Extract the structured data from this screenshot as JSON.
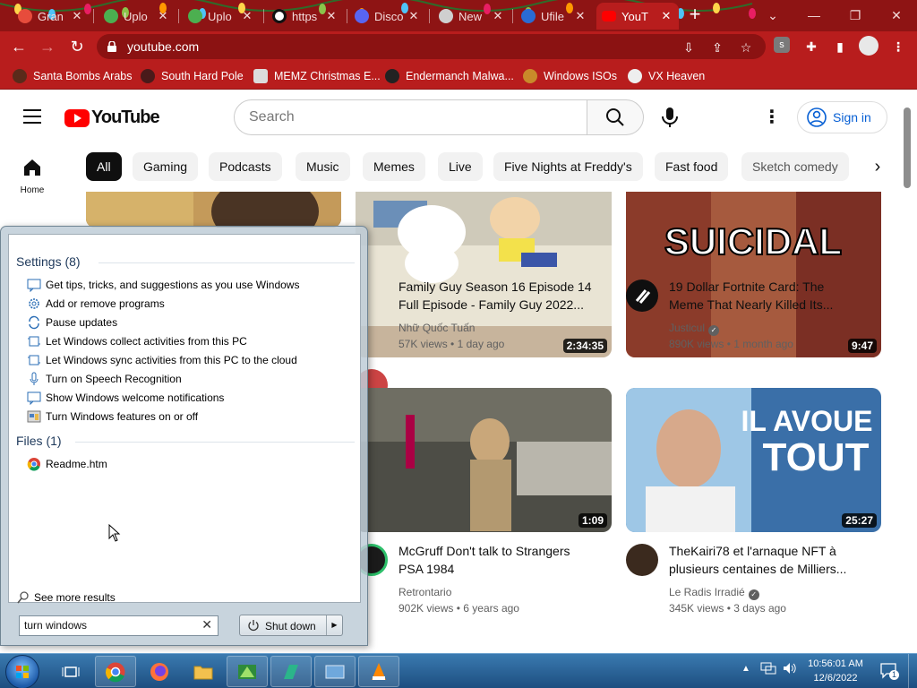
{
  "browser": {
    "tabs": [
      {
        "title": "Gran",
        "favicon_color": "#e74c3c"
      },
      {
        "title": "Uplo",
        "favicon_color": "#4caf50"
      },
      {
        "title": "Uplo",
        "favicon_color": "#4caf50"
      },
      {
        "title": "https",
        "favicon_color": "#ffffff"
      },
      {
        "title": "Disco",
        "favicon_color": "#5865f2"
      },
      {
        "title": "New",
        "favicon_color": "#cfcfcf"
      },
      {
        "title": "Ufile",
        "favicon_color": "#2a6bd3"
      },
      {
        "title": "YouT",
        "favicon_color": "#ff0000",
        "active": true
      }
    ],
    "new_tab_label": "+",
    "url": "youtube.com",
    "profile_badge": "s",
    "bookmarks": [
      {
        "label": "Santa Bombs Arabs"
      },
      {
        "label": "South Hard Pole"
      },
      {
        "label": "MEMZ Christmas E..."
      },
      {
        "label": "Endermanch Malwa..."
      },
      {
        "label": "Windows ISOs"
      },
      {
        "label": "VX Heaven"
      }
    ],
    "theme_color": "#b81d1d"
  },
  "youtube": {
    "logo_text": "YouTube",
    "search_placeholder": "Search",
    "signin_label": "Sign in",
    "home_label": "Home",
    "chips": [
      "All",
      "Gaming",
      "Podcasts",
      "Music",
      "Memes",
      "Live",
      "Five Nights at Freddy's",
      "Fast food",
      "Sketch comedy"
    ],
    "videos": [
      {
        "title_line1": "Family Guy Season 16 Episode 14",
        "title_line2": "Full Episode - Family Guy 2022...",
        "channel": "Nhữ Quốc Tuấn",
        "views": "57K views",
        "age": "1 day ago",
        "duration": "2:34:35",
        "verified": false
      },
      {
        "title_line1": "19 Dollar Fortnite Card: The",
        "title_line2": "Meme That Nearly Killed Its...",
        "channel": "Justicul",
        "views": "890K views",
        "age": "1 month ago",
        "duration": "9:47",
        "thumb_text": "SUICIDAL",
        "verified": true
      },
      {
        "title_line1": "McGruff Don't talk to Strangers",
        "title_line2": "PSA 1984",
        "channel": "Retrontario",
        "views": "902K views",
        "age": "6 years ago",
        "duration": "1:09",
        "verified": false
      },
      {
        "title_line1": "TheKairi78 et l'arnaque NFT à",
        "title_line2": "plusieurs centaines de Milliers...",
        "channel": "Le Radis Irradié",
        "views": "345K views",
        "age": "3 days ago",
        "duration": "25:27",
        "thumb_text_1": "IL AVOUE",
        "thumb_text_2": "TOUT",
        "verified": true
      }
    ],
    "meta_separator": "•"
  },
  "start_menu": {
    "settings_header": "Settings (8)",
    "settings_items": [
      "Get tips, tricks, and suggestions as you use Windows",
      "Add or remove programs",
      "Pause updates",
      "Let Windows collect activities from this PC",
      "Let Windows sync activities from this PC to the cloud",
      "Turn on Speech Recognition",
      "Show Windows welcome notifications",
      "Turn Windows features on or off"
    ],
    "files_header": "Files (1)",
    "files_items": [
      "Readme.htm"
    ],
    "see_more": "See more results",
    "search_value": "turn windows",
    "clear_glyph": "✕",
    "shutdown_label": "Shut down"
  },
  "taskbar": {
    "clock_time": "10:56:01 AM",
    "clock_date": "12/6/2022",
    "notification_count": "1"
  }
}
